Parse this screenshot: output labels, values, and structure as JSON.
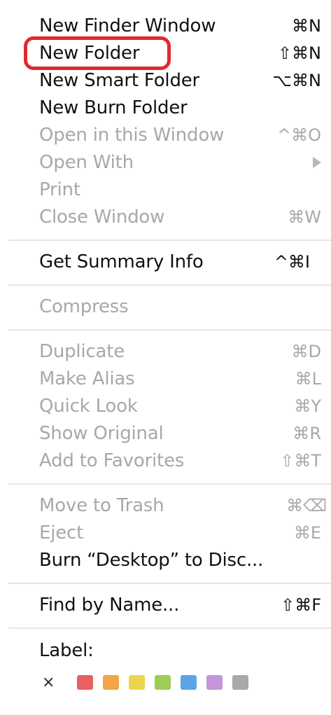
{
  "menu": {
    "items": [
      {
        "label": "New Finder Window",
        "shortcut": "⌘N"
      },
      {
        "label": "New Folder",
        "shortcut": "⇧⌘N"
      },
      {
        "label": "New Smart Folder",
        "shortcut": "⌥⌘N"
      },
      {
        "label": "New Burn Folder",
        "shortcut": ""
      },
      {
        "label": "Open in this Window",
        "shortcut": "^⌘O"
      },
      {
        "label": "Open With",
        "shortcut": ""
      },
      {
        "label": "Print",
        "shortcut": ""
      },
      {
        "label": "Close Window",
        "shortcut": "⌘W"
      },
      {
        "label": "Get Summary Info",
        "shortcut": "^⌘I"
      },
      {
        "label": "Compress",
        "shortcut": ""
      },
      {
        "label": "Duplicate",
        "shortcut": "⌘D"
      },
      {
        "label": "Make Alias",
        "shortcut": "⌘L"
      },
      {
        "label": "Quick Look",
        "shortcut": "⌘Y"
      },
      {
        "label": "Show Original",
        "shortcut": "⌘R"
      },
      {
        "label": "Add to Favorites",
        "shortcut": "⇧⌘T"
      },
      {
        "label": "Move to Trash",
        "shortcut": "⌘⌫"
      },
      {
        "label": "Eject",
        "shortcut": "⌘E"
      },
      {
        "label": "Burn “Desktop” to Disc...",
        "shortcut": ""
      },
      {
        "label": "Find by Name...",
        "shortcut": "⇧⌘F"
      }
    ],
    "label_section": {
      "title": "Label:",
      "clear_glyph": "×",
      "colors": [
        "#e8615f",
        "#f3a544",
        "#ecd44e",
        "#9fcc57",
        "#5aa5e8",
        "#c594d9",
        "#a9a9a9"
      ]
    },
    "highlight_color": "#e3282c"
  }
}
